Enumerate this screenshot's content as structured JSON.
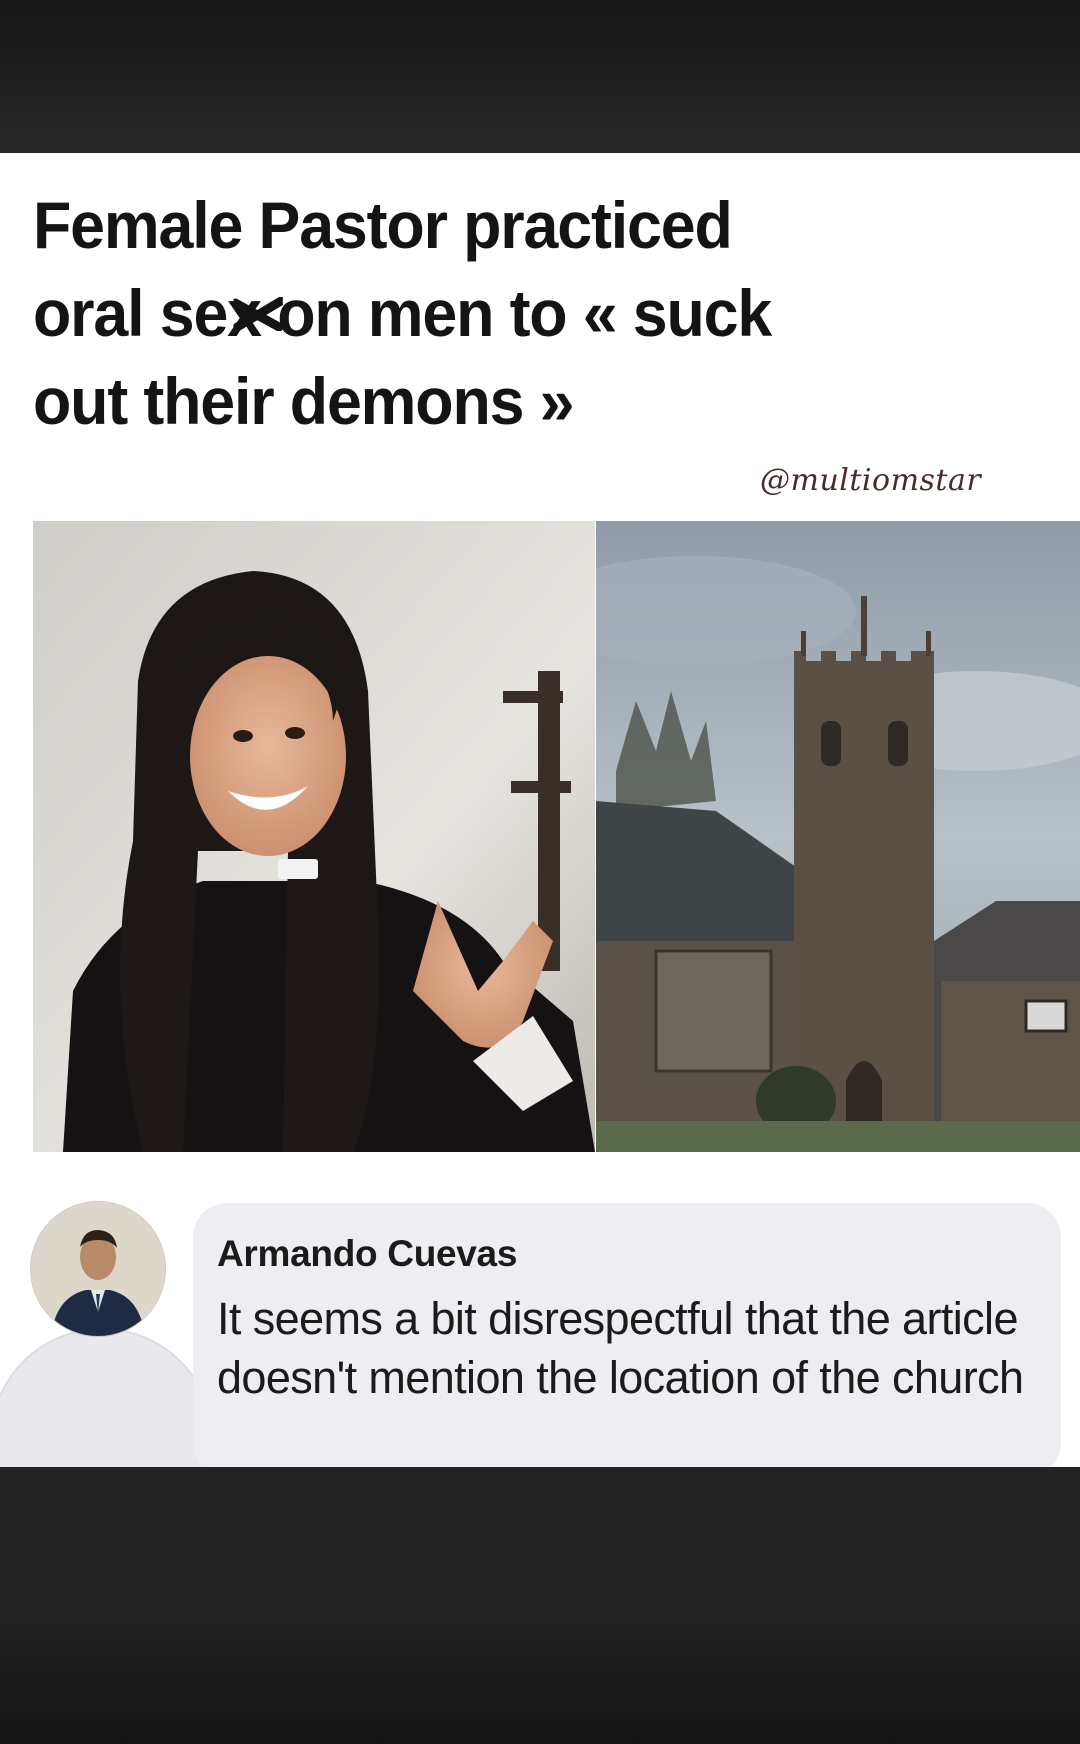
{
  "post": {
    "headline": {
      "line1": "Female Pastor practiced",
      "line2_before": "oral s",
      "line2_censored": "ex",
      "line2_after": " on men to « suck",
      "line3": "out their demons »"
    },
    "watermark": "@multiomstar",
    "images": {
      "left": "woman-in-clerical-collar-photo",
      "right": "stone-church-tower-photo"
    }
  },
  "comment": {
    "author": "Armando Cuevas",
    "text": "It seems a bit disrespectful that the article doesn't mention the location of the church"
  },
  "colors": {
    "background": "#232323",
    "card": "#ffffff",
    "headline_text": "#141414",
    "comment_bubble": "#ededf2",
    "watermark": "#4a2a2a"
  }
}
